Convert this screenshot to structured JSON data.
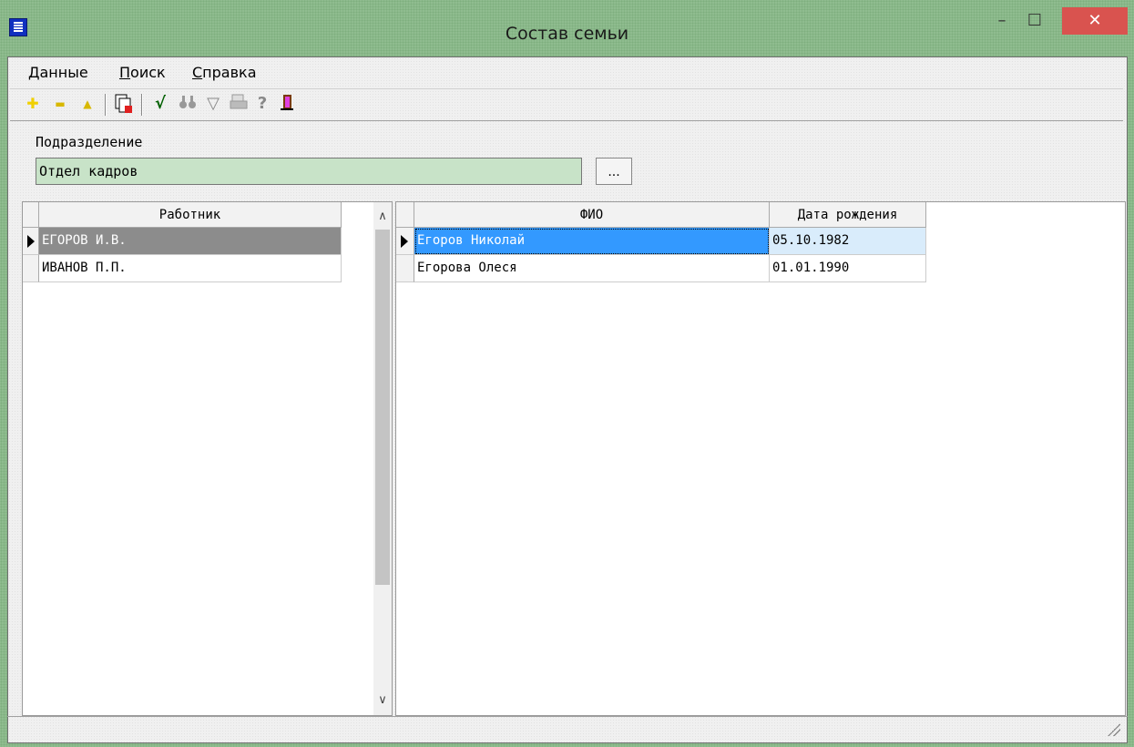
{
  "window": {
    "title": "Состав семьи"
  },
  "menu": [
    {
      "pre": "",
      "accel": "Д",
      "post": "анные"
    },
    {
      "pre": "",
      "accel": "П",
      "post": "оиск"
    },
    {
      "pre": "",
      "accel": "С",
      "post": "правка"
    }
  ],
  "toolbar": {
    "add_glyph": "✚",
    "remove_glyph": "▬",
    "edit_glyph": "▲",
    "check_glyph": "√",
    "find_glyph": "🔭",
    "filter_glyph": "▽",
    "print_glyph": "🖶",
    "help_glyph": "?",
    "exit_glyph": "🚪",
    "colors": {
      "add": "#f0d000",
      "remove": "#f0d000",
      "edit": "#f0d000",
      "check": "#006000"
    }
  },
  "filter": {
    "label": "Подразделение",
    "value": "Отдел кадров",
    "button": "..."
  },
  "left_grid": {
    "column": "Работник",
    "rows": [
      "ЕГОРОВ И.В.",
      "ИВАНОВ П.П."
    ],
    "selected_index": 0
  },
  "right_grid": {
    "columns": [
      "ФИО",
      "Дата рождения"
    ],
    "rows": [
      {
        "name": "Егоров Николай",
        "birth": "05.10.1982"
      },
      {
        "name": "Егорова Олеся",
        "birth": "01.01.1990"
      }
    ],
    "selected_index": 0
  },
  "scroll": {
    "up": "∧",
    "down": "∨"
  },
  "win_controls": {
    "min": "–",
    "max": "☐",
    "close": "✕"
  }
}
